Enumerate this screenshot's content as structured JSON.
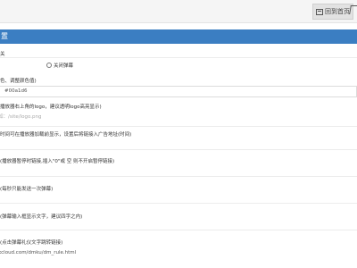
{
  "topbar": {
    "site_button_label": "回到首页"
  },
  "section": {
    "title": "置"
  },
  "items": [
    {
      "label": "关"
    },
    {
      "label": "关闭弹幕"
    },
    {
      "label": "色、调整颜色值)"
    },
    {
      "label": "#00a1d6"
    },
    {
      "label": "播放器右上角的logo，建议透明logo高亮显示)"
    },
    {
      "label": "如：/site/logo.png"
    },
    {
      "label": "时间可在播放器加载前显示，设置后将链接入广告地址(时间)"
    },
    {
      "label": "(播放器暂停时链接,插入\"0\"或 空 则不开启暂停链接)"
    },
    {
      "label": "(每秒只能发送一次弹幕)"
    },
    {
      "label": "(弹幕输入框显示文字，建议四字之内)"
    },
    {
      "label": "(点击弹幕礼仪文字跳转链接)"
    },
    {
      "label": "xcloud.com/dmku/dm_rule.html"
    }
  ]
}
